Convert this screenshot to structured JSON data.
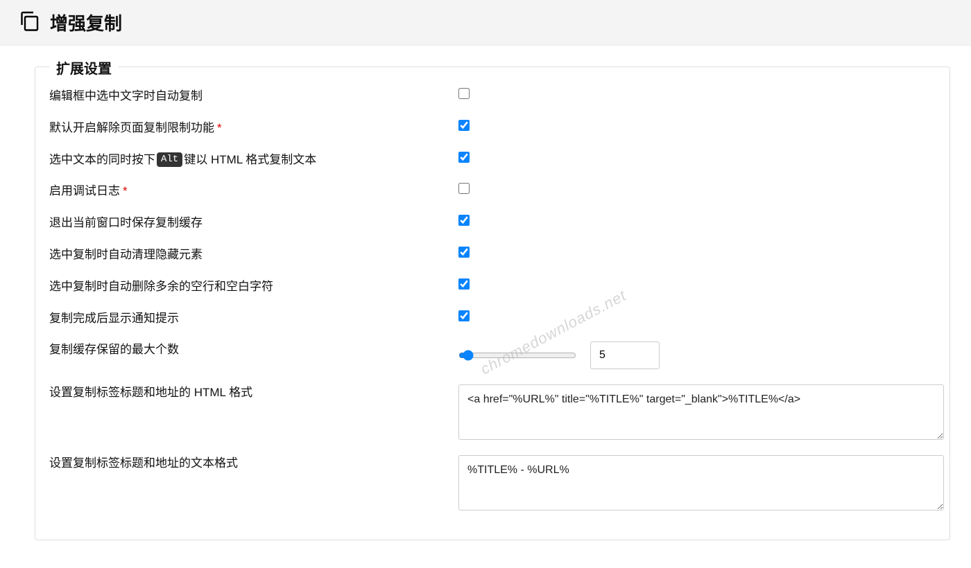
{
  "header": {
    "title": "增强复制"
  },
  "legend": "扩展设置",
  "rows": {
    "auto_copy_on_select": {
      "label": "编辑框中选中文字时自动复制",
      "checked": false,
      "required": false
    },
    "unlock_copy_default": {
      "label": "默认开启解除页面复制限制功能",
      "checked": true,
      "required": true
    },
    "alt_html_copy": {
      "prefix": "选中文本的同时按下 ",
      "kbd": "Alt",
      "suffix": " 键以 HTML 格式复制文本",
      "checked": true,
      "required": false
    },
    "debug_log": {
      "label": "启用调试日志",
      "checked": false,
      "required": true
    },
    "save_cache_on_close": {
      "label": "退出当前窗口时保存复制缓存",
      "checked": true,
      "required": false
    },
    "clean_hidden": {
      "label": "选中复制时自动清理隐藏元素",
      "checked": true,
      "required": false
    },
    "trim_whitespace": {
      "label": "选中复制时自动删除多余的空行和空白字符",
      "checked": true,
      "required": false
    },
    "show_notification": {
      "label": "复制完成后显示通知提示",
      "checked": true,
      "required": false
    },
    "max_cache": {
      "label": "复制缓存保留的最大个数",
      "value": "5"
    },
    "html_format": {
      "label": "设置复制标签标题和地址的 HTML 格式",
      "value": "<a href=\"%URL%\" title=\"%TITLE%\" target=\"_blank\">%TITLE%</a>"
    },
    "text_format": {
      "label": "设置复制标签标题和地址的文本格式",
      "value": "%TITLE% - %URL%"
    }
  },
  "watermark": "chromedownloads.net"
}
